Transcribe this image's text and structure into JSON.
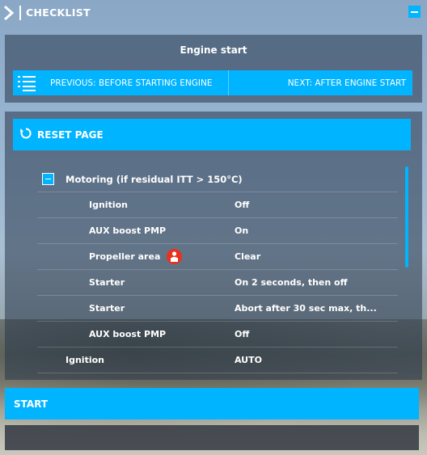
{
  "window": {
    "title": "CHECKLIST"
  },
  "checklist": {
    "title": "Engine start",
    "previous_label": "PREVIOUS: BEFORE STARTING ENGINE",
    "next_label": "NEXT: AFTER ENGINE START",
    "reset_label": "RESET PAGE",
    "group": {
      "label": "Motoring (if residual ITT > 150°C)",
      "items": [
        {
          "item": "Ignition",
          "value": "Off"
        },
        {
          "item": "AUX boost PMP",
          "value": "On"
        },
        {
          "item": "Propeller area",
          "value": "Clear",
          "icon": "person-warning-icon"
        },
        {
          "item": "Starter",
          "value": "On 2 seconds, then off"
        },
        {
          "item": "Starter",
          "value": "Abort after 30 sec max, th..."
        },
        {
          "item": "AUX boost PMP",
          "value": "Off"
        }
      ]
    },
    "top_items": [
      {
        "item": "Ignition",
        "value": "AUTO"
      }
    ],
    "start_label": "START"
  },
  "colors": {
    "accent": "#00b4ff",
    "warning": "#e8321e"
  }
}
